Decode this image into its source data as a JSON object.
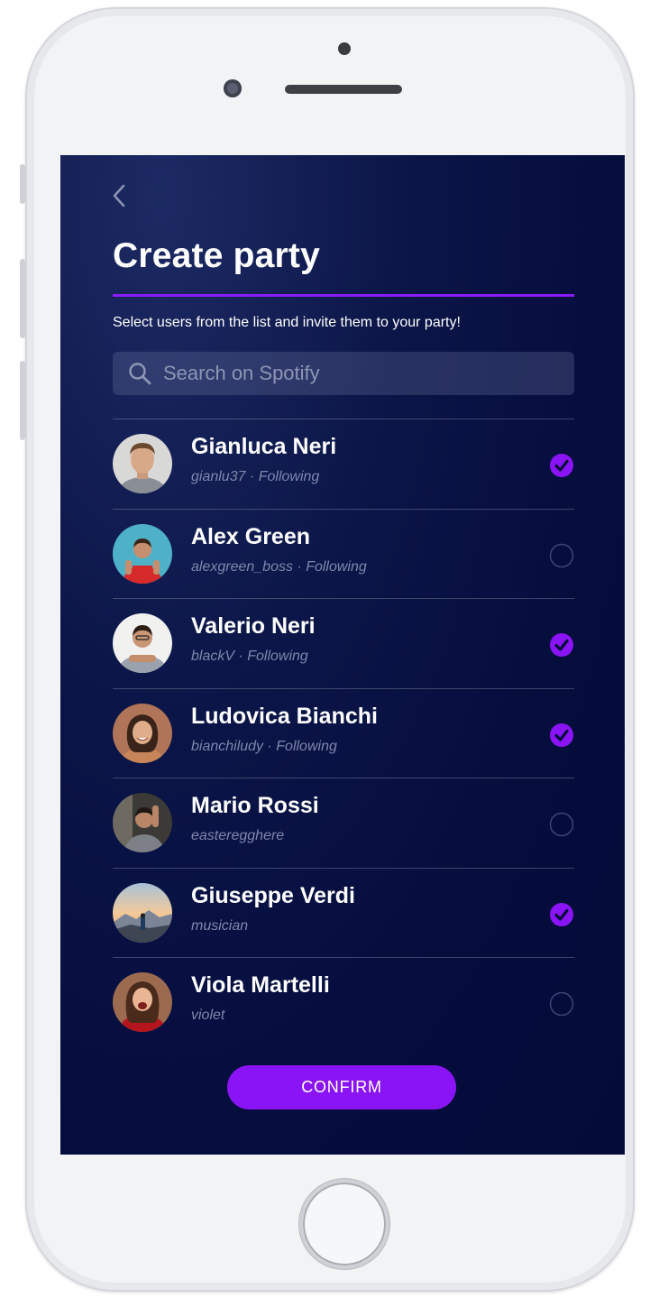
{
  "header": {
    "title": "Create party",
    "subtitle": "Select users from the list and invite them to your party!"
  },
  "search": {
    "placeholder": "Search on Spotify",
    "value": ""
  },
  "users": [
    {
      "name": "Gianluca Neri",
      "meta": "gianlu37 · Following",
      "selected": true
    },
    {
      "name": "Alex Green",
      "meta": "alexgreen_boss · Following",
      "selected": false
    },
    {
      "name": "Valerio Neri",
      "meta": "blackV · Following",
      "selected": true
    },
    {
      "name": "Ludovica Bianchi",
      "meta": "bianchiludy · Following",
      "selected": true
    },
    {
      "name": "Mario Rossi",
      "meta": "easteregghere",
      "selected": false
    },
    {
      "name": "Giuseppe Verdi",
      "meta": "musician",
      "selected": true
    },
    {
      "name": "Viola Martelli",
      "meta": "violet",
      "selected": false
    }
  ],
  "footer": {
    "confirm_label": "CONFIRM"
  },
  "colors": {
    "accent": "#8a14f5",
    "background": "#050d3d",
    "secondary_text": "#7f87ac"
  },
  "icons": {
    "back": "chevron-left-icon",
    "search": "search-icon",
    "selected": "check-circle-icon",
    "unselected": "empty-circle-icon"
  }
}
